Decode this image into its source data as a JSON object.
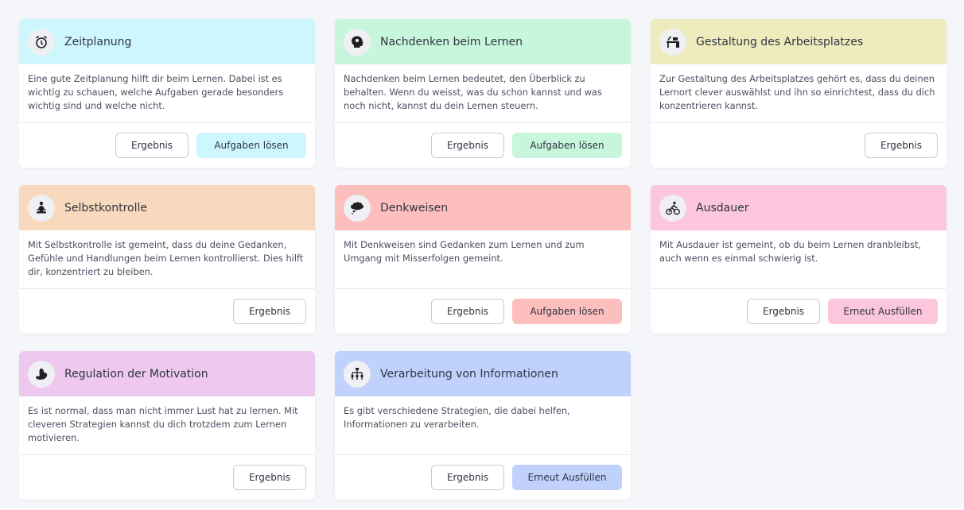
{
  "cards": [
    {
      "title": "Zeitplanung",
      "icon": "alarm-clock-icon",
      "color": "#cdf6fd",
      "desc": "Eine gute Zeitplanung hilft dir beim Lernen. Dabei ist es wichtig zu schauen, welche Aufgaben gerade besonders wichtig sind und welche nicht.",
      "result": "Ergebnis",
      "action": "Aufgaben lösen"
    },
    {
      "title": "Nachdenken beim Lernen",
      "icon": "head-thinking-icon",
      "color": "#c8f6dc",
      "desc": "Nachdenken beim Lernen bedeutet, den Überblick zu behalten. Wenn du weisst, was du schon kannst und was noch nicht, kannst du dein Lernen steuern.",
      "result": "Ergebnis",
      "action": "Aufgaben lösen"
    },
    {
      "title": "Gestaltung des Arbeitsplatzes",
      "icon": "desk-icon",
      "color": "#eeecbd",
      "desc": "Zur Gestaltung des Arbeitsplatzes gehört es, dass du deinen Lernort clever auswählst und ihn so einrichtest, dass du dich konzentrieren kannst.",
      "result": "Ergebnis",
      "action": ""
    },
    {
      "title": "Selbstkontrolle",
      "icon": "meditation-icon",
      "color": "#f8d9bd",
      "desc": "Mit Selbstkontrolle ist gemeint, dass du deine Gedanken, Gefühle und Handlungen beim Lernen kontrollierst. Dies hilft dir, konzentriert zu bleiben.",
      "result": "Ergebnis",
      "action": ""
    },
    {
      "title": "Denkweisen",
      "icon": "thought-bubble-icon",
      "color": "#fdbfbd",
      "desc": "Mit Denkweisen sind Gedanken zum Lernen und zum Umgang mit Misserfolgen gemeint.",
      "result": "Ergebnis",
      "action": "Aufgaben lösen"
    },
    {
      "title": "Ausdauer",
      "icon": "cyclist-icon",
      "color": "#fcc6dd",
      "desc": "Mit Ausdauer ist gemeint, ob du beim Lernen dranbleibst, auch wenn es einmal schwierig ist.",
      "result": "Ergebnis",
      "action": "Erneut Ausfüllen"
    },
    {
      "title": "Regulation der Motivation",
      "icon": "flexed-arm-icon",
      "color": "#eec8ee",
      "desc": "Es ist normal, dass man nicht immer Lust hat zu lernen. Mit cleveren Strategien kannst du dich trotzdem zum Lernen motivieren.",
      "result": "Ergebnis",
      "action": ""
    },
    {
      "title": "Verarbeitung von Informationen",
      "icon": "hierarchy-icon",
      "color": "#c0d1fb",
      "desc": "Es gibt verschiedene Strategien, die dabei helfen, Informationen zu verarbeiten.",
      "result": "Ergebnis",
      "action": "Erneut Ausfüllen"
    }
  ]
}
